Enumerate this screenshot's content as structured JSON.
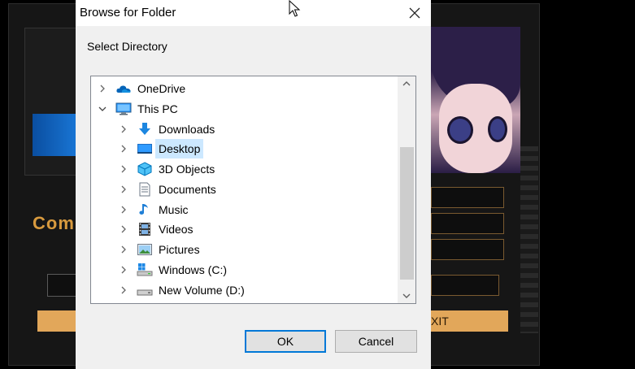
{
  "background_app": {
    "title_fragment": "Com",
    "exit_button_fragment": "XIT"
  },
  "dialog": {
    "title": "Browse for Folder",
    "prompt": "Select Directory",
    "tree": [
      {
        "label": "OneDrive",
        "icon": "onedrive-cloud-icon",
        "expander": "collapsed",
        "selected": false
      },
      {
        "label": "This PC",
        "icon": "computer-icon",
        "expander": "expanded",
        "selected": false
      },
      {
        "label": "Downloads",
        "icon": "downloads-arrow-icon",
        "expander": "collapsed",
        "selected": false
      },
      {
        "label": "Desktop",
        "icon": "desktop-icon",
        "expander": "collapsed",
        "selected": true
      },
      {
        "label": "3D Objects",
        "icon": "3d-objects-icon",
        "expander": "collapsed",
        "selected": false
      },
      {
        "label": "Documents",
        "icon": "documents-icon",
        "expander": "collapsed",
        "selected": false
      },
      {
        "label": "Music",
        "icon": "music-note-icon",
        "expander": "collapsed",
        "selected": false
      },
      {
        "label": "Videos",
        "icon": "videos-film-icon",
        "expander": "collapsed",
        "selected": false
      },
      {
        "label": "Pictures",
        "icon": "pictures-icon",
        "expander": "collapsed",
        "selected": false
      },
      {
        "label": "Windows (C:)",
        "icon": "windows-drive-icon",
        "expander": "collapsed",
        "selected": false
      },
      {
        "label": "New Volume (D:)",
        "icon": "drive-icon",
        "expander": "collapsed",
        "selected": false
      }
    ],
    "ok_label": "OK",
    "cancel_label": "Cancel"
  },
  "colors": {
    "selection": "#cce8ff",
    "accent": "#0078d7",
    "background_accent": "#e2a75a"
  }
}
